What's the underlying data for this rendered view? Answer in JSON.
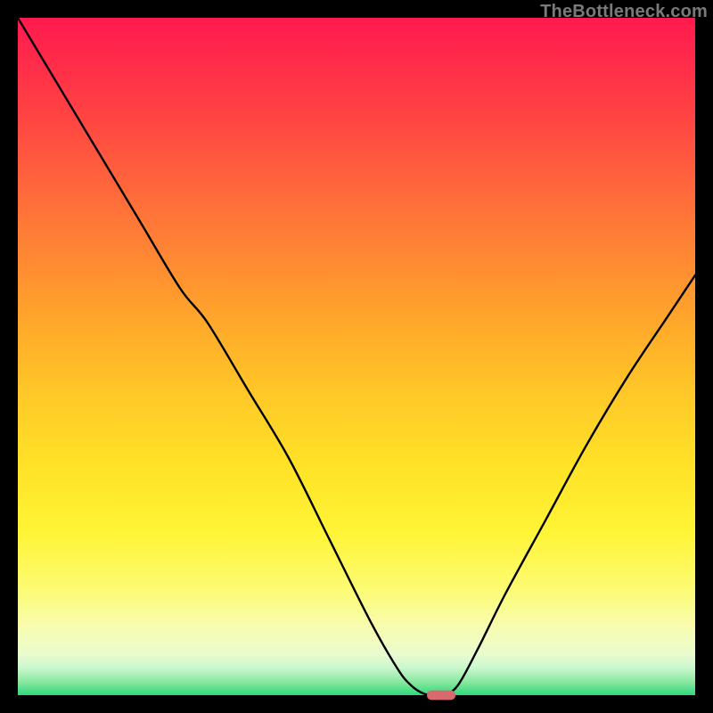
{
  "watermark": "TheBottleneck.com",
  "chart_data": {
    "type": "line",
    "title": "",
    "xlabel": "",
    "ylabel": "",
    "xlim": [
      0,
      100
    ],
    "ylim": [
      0,
      100
    ],
    "grid": false,
    "legend": false,
    "background_gradient": {
      "stops": [
        {
          "pos": 0,
          "color": "#ff1a4d"
        },
        {
          "pos": 6,
          "color": "#ff2a4a"
        },
        {
          "pos": 15,
          "color": "#ff4542"
        },
        {
          "pos": 26,
          "color": "#ff6a3a"
        },
        {
          "pos": 36,
          "color": "#ff8a32"
        },
        {
          "pos": 46,
          "color": "#ffab2a"
        },
        {
          "pos": 56,
          "color": "#ffc927"
        },
        {
          "pos": 66,
          "color": "#ffe227"
        },
        {
          "pos": 76,
          "color": "#fff436"
        },
        {
          "pos": 84,
          "color": "#fcfb70"
        },
        {
          "pos": 90,
          "color": "#f8fcb0"
        },
        {
          "pos": 94,
          "color": "#e9fccf"
        },
        {
          "pos": 96,
          "color": "#c9f7ce"
        },
        {
          "pos": 98,
          "color": "#8be8a0"
        },
        {
          "pos": 100,
          "color": "#2fd97b"
        }
      ]
    },
    "series": [
      {
        "name": "bottleneck-curve",
        "x": [
          0,
          6,
          12,
          18,
          24,
          28,
          34,
          40,
          46,
          52,
          56,
          58,
          60,
          62,
          63,
          65,
          68,
          72,
          78,
          84,
          90,
          96,
          100
        ],
        "y": [
          100,
          90,
          80,
          70,
          60,
          55,
          45,
          35,
          23,
          11,
          4,
          1.5,
          0.2,
          0,
          0,
          1.5,
          7,
          15,
          26,
          37,
          47,
          56,
          62
        ]
      }
    ],
    "marker": {
      "name": "optimum-marker",
      "x": 62.5,
      "y": 0,
      "width_pct": 4.2,
      "height_pct": 1.4,
      "color": "#d86a6f"
    },
    "frame_color": "#000000",
    "frame_thickness_px": 20
  }
}
